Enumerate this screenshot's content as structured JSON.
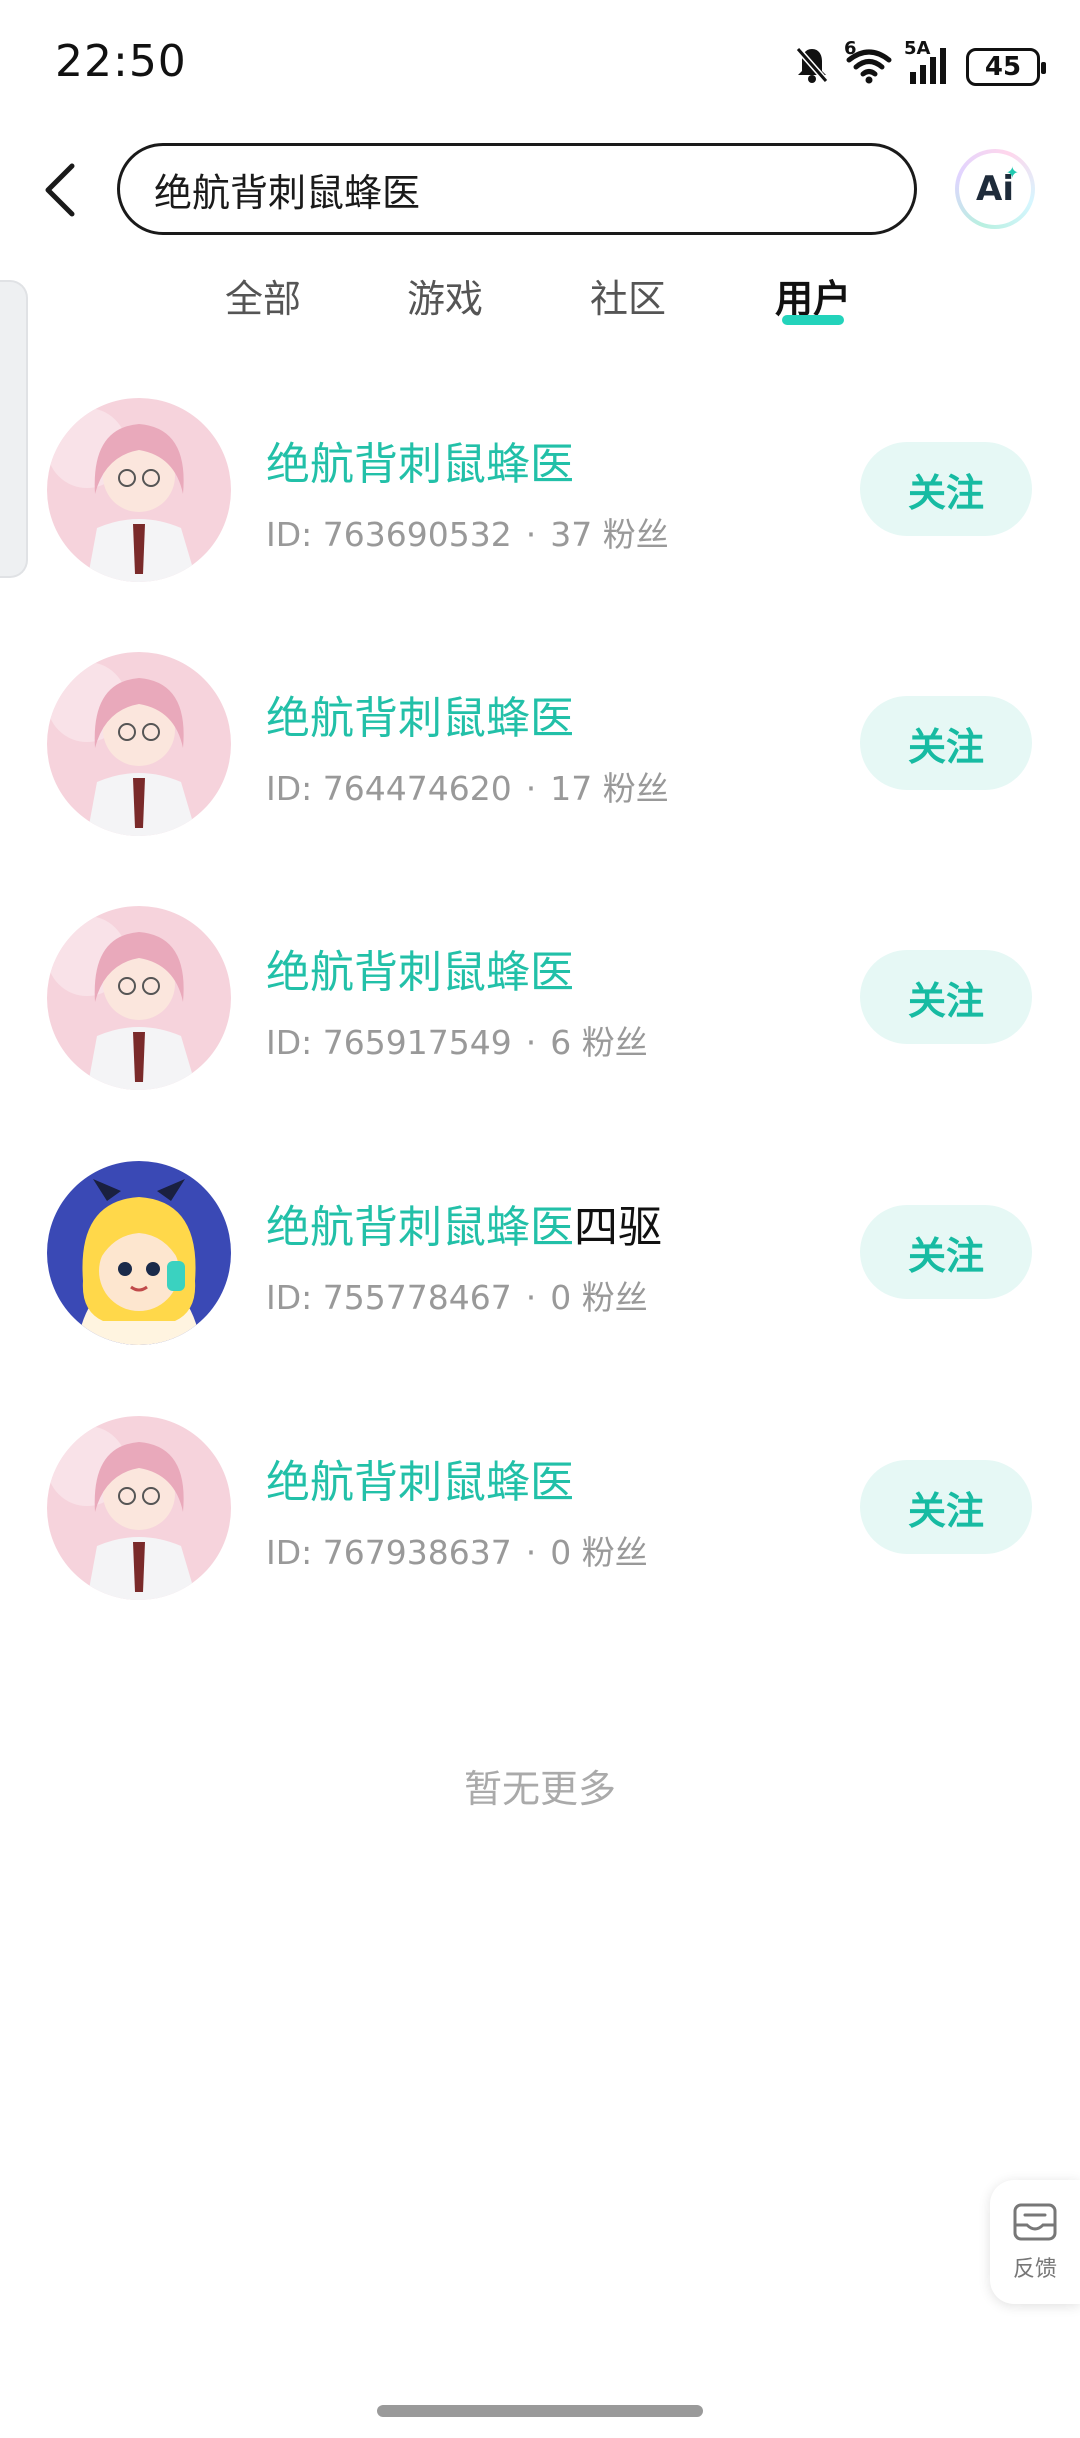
{
  "status_bar": {
    "time": "22:50",
    "icons": [
      "bell-muted-icon",
      "wifi-icon",
      "signal-icon"
    ],
    "wifi_label": "6",
    "network_label": "5A",
    "battery": "45"
  },
  "search": {
    "query": "绝航背刺鼠蜂医",
    "ai_label": "Ai"
  },
  "tabs": [
    {
      "label": "全部",
      "active": false
    },
    {
      "label": "游戏",
      "active": false
    },
    {
      "label": "社区",
      "active": false
    },
    {
      "label": "用户",
      "active": true
    }
  ],
  "users": [
    {
      "name": "绝航背刺鼠蜂医",
      "name_suffix": "",
      "id_text": "ID: 763690532",
      "fans": "37 粉丝",
      "avatar": "pink-hair-avatar",
      "follow_label": "关注"
    },
    {
      "name": "绝航背刺鼠蜂医",
      "name_suffix": "",
      "id_text": "ID: 764474620",
      "fans": "17 粉丝",
      "avatar": "pink-hair-avatar",
      "follow_label": "关注"
    },
    {
      "name": "绝航背刺鼠蜂医",
      "name_suffix": "",
      "id_text": "ID: 765917549",
      "fans": "6 粉丝",
      "avatar": "pink-hair-avatar",
      "follow_label": "关注"
    },
    {
      "name": "绝航背刺鼠蜂医",
      "name_suffix": "四驱",
      "id_text": "ID: 755778467",
      "fans": "0 粉丝",
      "avatar": "blonde-mascot-avatar",
      "follow_label": "关注"
    },
    {
      "name": "绝航背刺鼠蜂医",
      "name_suffix": "",
      "id_text": "ID: 767938637",
      "fans": "0 粉丝",
      "avatar": "pink-hair-avatar",
      "follow_label": "关注"
    }
  ],
  "meta_separator": "·",
  "list_end": "暂无更多",
  "feedback": {
    "label": "反馈"
  },
  "colors": {
    "accent": "#22c0a8",
    "follow_bg": "#e6f8f5",
    "tab_underline": "#23d3bb"
  }
}
